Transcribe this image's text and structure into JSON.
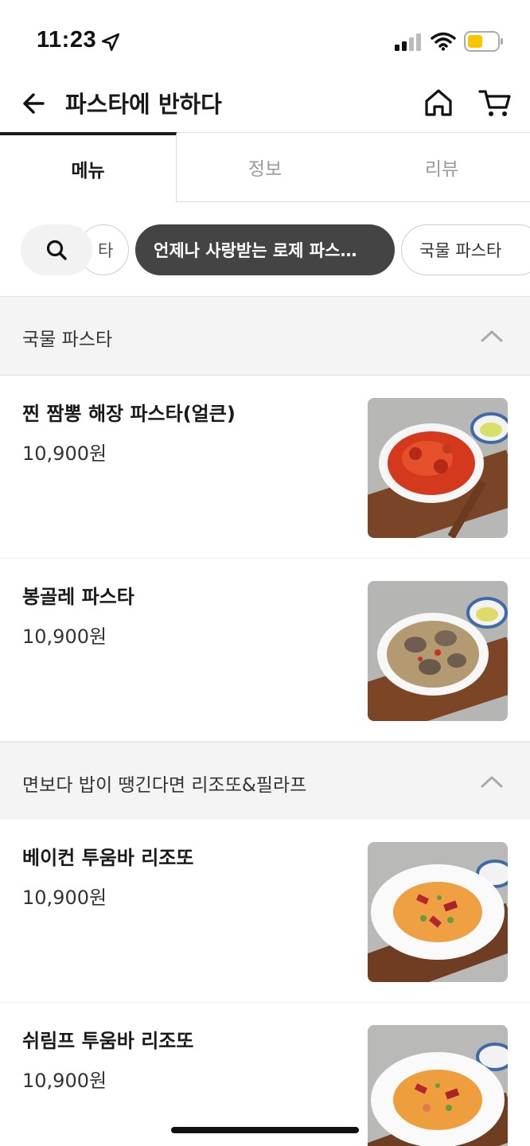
{
  "status": {
    "time": "11:23"
  },
  "header": {
    "title": "파스타에 반하다"
  },
  "tabs": [
    {
      "label": "메뉴"
    },
    {
      "label": "정보"
    },
    {
      "label": "리뷰"
    }
  ],
  "chips": {
    "cut_label": "타",
    "active_label": "언제나 사랑받는 로제 파스…",
    "next_label": "국물 파스타"
  },
  "sections": [
    {
      "title": "국물 파스타",
      "items": [
        {
          "name": "찐 짬뽕 해장 파스타(얼큰)",
          "price": "10,900원"
        },
        {
          "name": "봉골레 파스타",
          "price": "10,900원"
        }
      ]
    },
    {
      "title": "면보다 밥이 땡긴다면 리조또&필라프",
      "items": [
        {
          "name": "베이컨 투움바 리조또",
          "price": "10,900원"
        },
        {
          "name": "쉬림프 투움바 리조또",
          "price": "10,900원"
        }
      ]
    }
  ],
  "colors": {
    "active_chip": "#444444",
    "section_bg": "#f4f4f4",
    "battery": "#f7c600"
  },
  "icons": [
    "location-arrow-icon",
    "signal-icon",
    "wifi-icon",
    "battery-icon",
    "back-arrow-icon",
    "home-icon",
    "cart-icon",
    "search-icon",
    "chevron-up-icon"
  ]
}
